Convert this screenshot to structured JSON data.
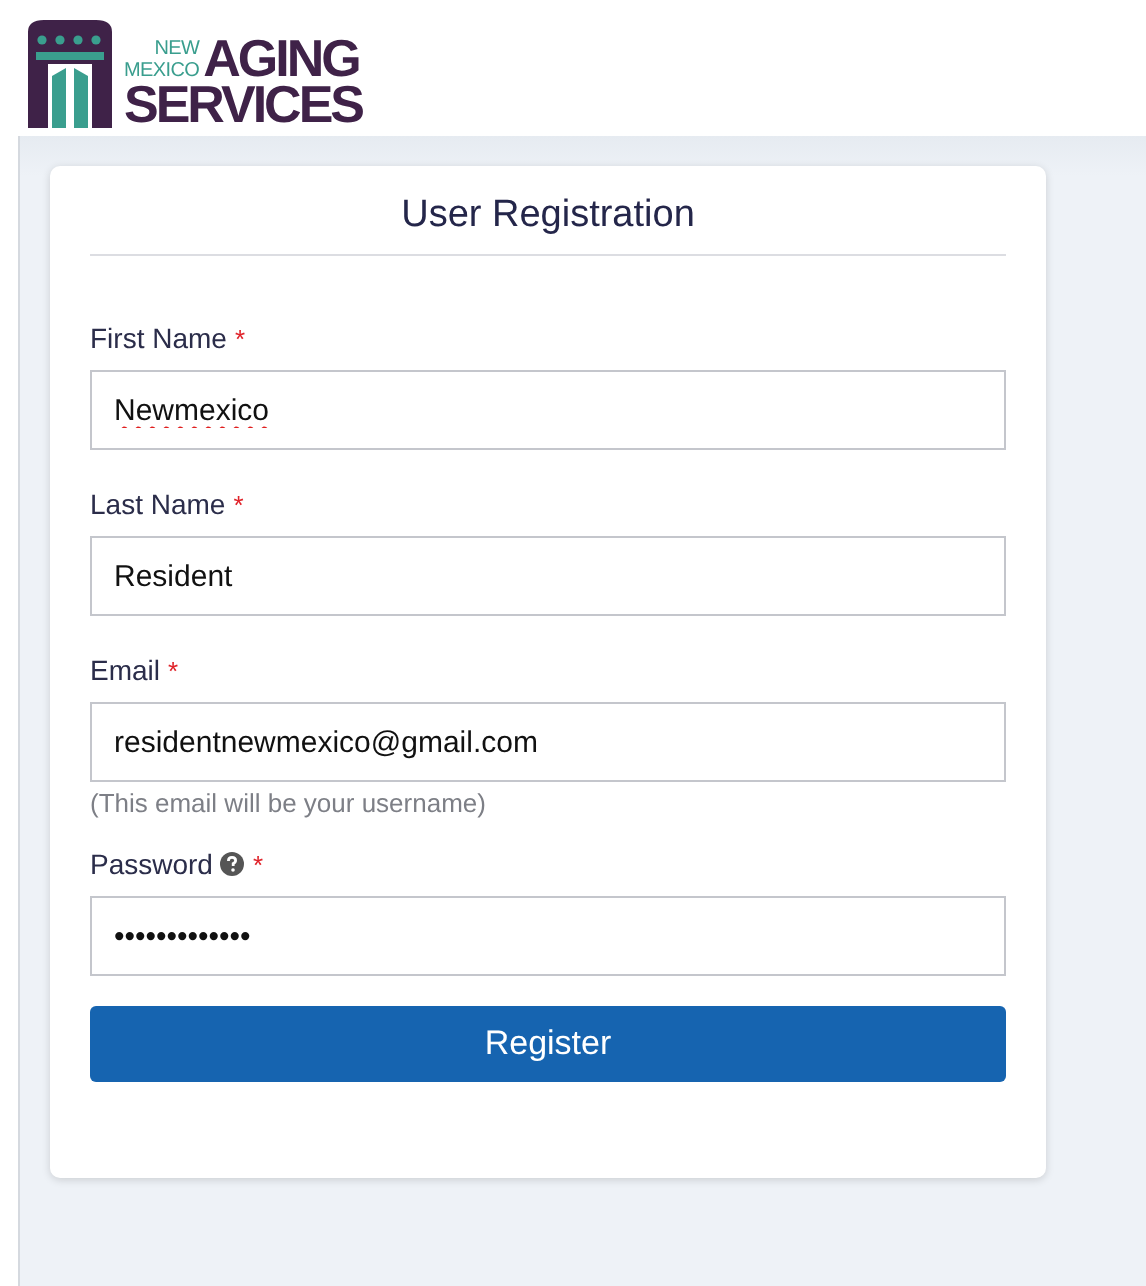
{
  "logo": {
    "small_lines": [
      "NEW",
      "MEXICO"
    ],
    "large_lines": [
      "AGING",
      "SERVICES"
    ]
  },
  "form": {
    "title": "User Registration",
    "fields": [
      {
        "label": "First Name",
        "required": true,
        "value": "Newmexico",
        "spelling_error": true,
        "help_icon": false
      },
      {
        "label": "Last Name",
        "required": true,
        "value": "Resident",
        "spelling_error": false,
        "help_icon": false
      },
      {
        "label": "Email",
        "required": true,
        "value": "residentnewmexico@gmail.com",
        "spelling_error": false,
        "help_icon": false,
        "hint": "(This email will be your username)"
      },
      {
        "label": "Password",
        "required": true,
        "value": "•••••••••••••",
        "spelling_error": false,
        "help_icon": true
      }
    ],
    "required_mark": "*",
    "submit": "Register"
  }
}
